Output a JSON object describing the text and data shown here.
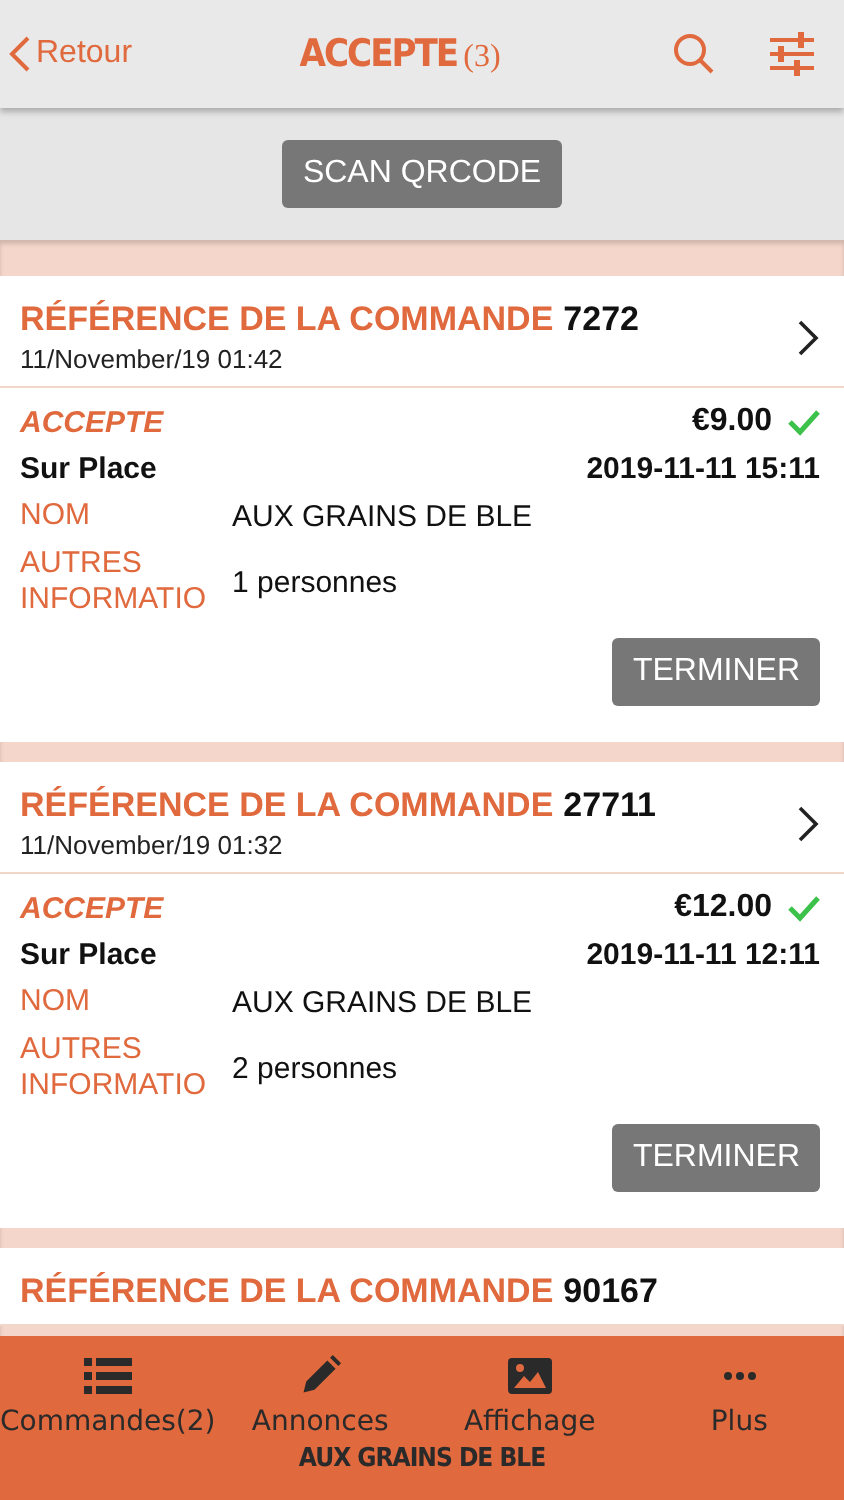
{
  "header": {
    "back": "Retour",
    "title": "ACCEPTE",
    "count": "(3)"
  },
  "scan_button": "SCAN QRCODE",
  "orders": [
    {
      "ref_label": "RÉFÉRENCE DE LA COMMANDE",
      "ref": "7272",
      "date": "11/November/19 01:42",
      "status": "ACCEPTE",
      "price": "€9.00",
      "confirmed": true,
      "mode": "Sur Place",
      "datetime": "2019-11-11 15:11",
      "fields": [
        {
          "label": "NOM",
          "value": "AUX GRAINS DE BLE"
        },
        {
          "label": "AUTRES INFORMATIO",
          "value": "1 personnes"
        }
      ],
      "action": "TERMINER"
    },
    {
      "ref_label": "RÉFÉRENCE DE LA COMMANDE",
      "ref": "27711",
      "date": "11/November/19 01:32",
      "status": "ACCEPTE",
      "price": "€12.00",
      "confirmed": true,
      "mode": "Sur Place",
      "datetime": "2019-11-11 12:11",
      "fields": [
        {
          "label": "NOM",
          "value": "AUX GRAINS DE BLE"
        },
        {
          "label": "AUTRES INFORMATIO",
          "value": "2 personnes"
        }
      ],
      "action": "TERMINER"
    },
    {
      "ref_label": "RÉFÉRENCE DE LA COMMANDE",
      "ref": "90167"
    }
  ],
  "tabs": [
    {
      "kind": "list",
      "label": "Commandes(2)"
    },
    {
      "kind": "pencil",
      "label": "Annonces"
    },
    {
      "kind": "image",
      "label": "Affichage"
    },
    {
      "kind": "more",
      "label": "Plus"
    }
  ],
  "footer": "AUX GRAINS DE BLE"
}
